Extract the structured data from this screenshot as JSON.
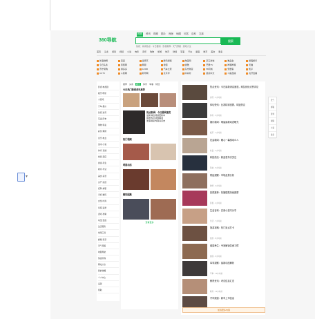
{
  "header": {
    "logo_text": "360导航",
    "top_links": [
      "网页",
      "资讯",
      "视频",
      "图片",
      "良医",
      "地图",
      "问答",
      "百科",
      "文库"
    ],
    "search_button": "搜索",
    "hot_words": "热搜：新闻热点 · 今日要闻 · 影视推荐 · 天气预报 · 游戏大全"
  },
  "categories": [
    "首页",
    "头条",
    "游戏",
    "视频",
    "小说",
    "电影",
    "音乐",
    "购物",
    "旅游",
    "体育",
    "财经",
    "军事",
    "汽车",
    "星座",
    "教育",
    "美食",
    "更多"
  ],
  "sites": [
    "新浪微博",
    "百度",
    "爱奇艺",
    "腾讯视频",
    "淘宝网",
    "京东商城",
    "唯品会",
    "携程旅行",
    "今日头条",
    "凤凰网",
    "网易",
    "搜狐",
    "优酷",
    "芒果TV",
    "哔哩哔哩",
    "天猫",
    "苏宁易购",
    "拼多多",
    "12306",
    "汽车之家",
    "东方财富",
    "58同城",
    "安居客",
    "知乎",
    "CCTV",
    "人民网",
    "新华网",
    "太平洋",
    "中关村",
    "起点中文",
    "斗鱼直播",
    "虎牙直播"
  ],
  "left_menu": [
    "影视·电视剧",
    "娱乐·明星",
    "小游戏",
    "汽车·报价",
    "新闻·资讯",
    "军事·历史",
    "购物·特卖",
    "彩票·理财",
    "音乐·电台",
    "读书·小说",
    "体育·直播",
    "旅游·酒店",
    "健康·养生",
    "教育·考试",
    "美食·菜谱",
    "房产·家居",
    "招聘·求职",
    "手机·数码",
    "女性·时尚",
    "星座·运势",
    "游戏·攻略",
    "动漫·漫画",
    "生活服务",
    "常用工具",
    "邮箱·登录",
    "天气预报",
    "地图导航",
    "快递查询",
    "网址大全",
    "我的收藏",
    "个人中心",
    "设置",
    "帮助"
  ],
  "middle": {
    "tabs": [
      "推荐",
      "头条",
      "娱乐",
      "体育",
      "军事",
      "财经"
    ],
    "headline": "今日热门新闻资讯推荐",
    "story_title": "热点新闻：今日要闻速览",
    "story_lines": [
      "最新消息持续更新中",
      "网友热议话题精选",
      "更多精彩内容请点击"
    ],
    "section2": "热门视频",
    "section3": "明星动态",
    "section4": "精彩图集",
    "bottom_link": "查看更多"
  },
  "sidebar_tools": [
    "天气",
    "邮箱",
    "游戏",
    "视频",
    "小说",
    "更多"
  ],
  "news_list": [
    {
      "title": "热点资讯：今日最新消息速递，网友纷纷点赞评论",
      "meta": "资讯 · 2小时前"
    },
    {
      "title": "体坛快讯：比赛精彩回顾，球迷热议",
      "meta": "体育 · 3小时前"
    },
    {
      "title": "娱乐新闻：明星最新动态曝光",
      "meta": "娱乐 · 1小时前"
    },
    {
      "title": "社会新闻：暖心一幕感动众人",
      "meta": "社会 · 4小时前"
    },
    {
      "title": "科技前沿：新品发布引关注",
      "meta": "科技 · 5小时前"
    },
    {
      "title": "财经观察：市场走势分析",
      "meta": "财经 · 6小时前"
    },
    {
      "title": "影视推荐：热播剧集持续霸屏",
      "meta": "影视 · 2小时前"
    },
    {
      "title": "生活百科：实用小技巧分享",
      "meta": "生活 · 7小时前"
    },
    {
      "title": "旅游攻略：热门景点打卡",
      "meta": "旅游 · 8小时前"
    },
    {
      "title": "健康养生：专家解读饮食习惯",
      "meta": "健康 · 9小时前"
    },
    {
      "title": "军事观察：最新动态解析",
      "meta": "军事 · 10小时前"
    },
    {
      "title": "教育资讯：考试信息汇总",
      "meta": "教育 · 11小时前"
    },
    {
      "title": "汽车频道：新车上市信息",
      "meta": "汽车 · 12小时前"
    }
  ],
  "more_button": "加载更多内容"
}
